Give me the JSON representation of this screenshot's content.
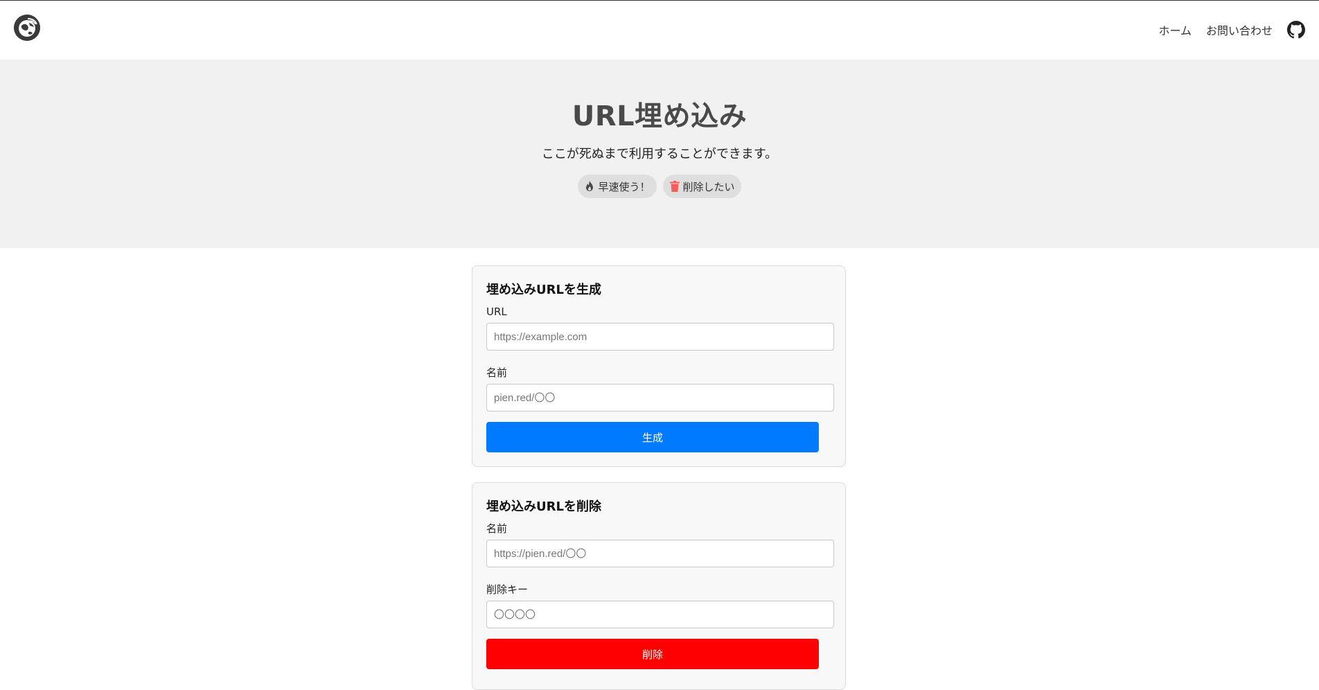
{
  "header": {
    "logo_icon": "globe-logo-icon",
    "nav": [
      {
        "label": "ホーム"
      },
      {
        "label": "お問い合わせ"
      }
    ],
    "github_icon": "github-icon"
  },
  "hero": {
    "title": "URL埋め込み",
    "subtitle": "ここが死ぬまで利用することができます。",
    "use_button": {
      "label": "早速使う！",
      "icon": "fire-icon"
    },
    "delete_button": {
      "label": "削除したい",
      "icon": "trash-icon",
      "icon_color": "#ff5b5b"
    }
  },
  "create_form": {
    "title": "埋め込みURLを生成",
    "url_label": "URL",
    "url_placeholder": "https://example.com",
    "name_label": "名前",
    "name_placeholder": "pien.red/〇〇",
    "submit_label": "生成",
    "submit_color": "#007bff"
  },
  "delete_form": {
    "title": "埋め込みURLを削除",
    "name_label": "名前",
    "name_placeholder": "https://pien.red/〇〇",
    "key_label": "削除キー",
    "key_placeholder": "〇〇〇〇",
    "submit_label": "削除",
    "submit_color": "#ff0000"
  }
}
